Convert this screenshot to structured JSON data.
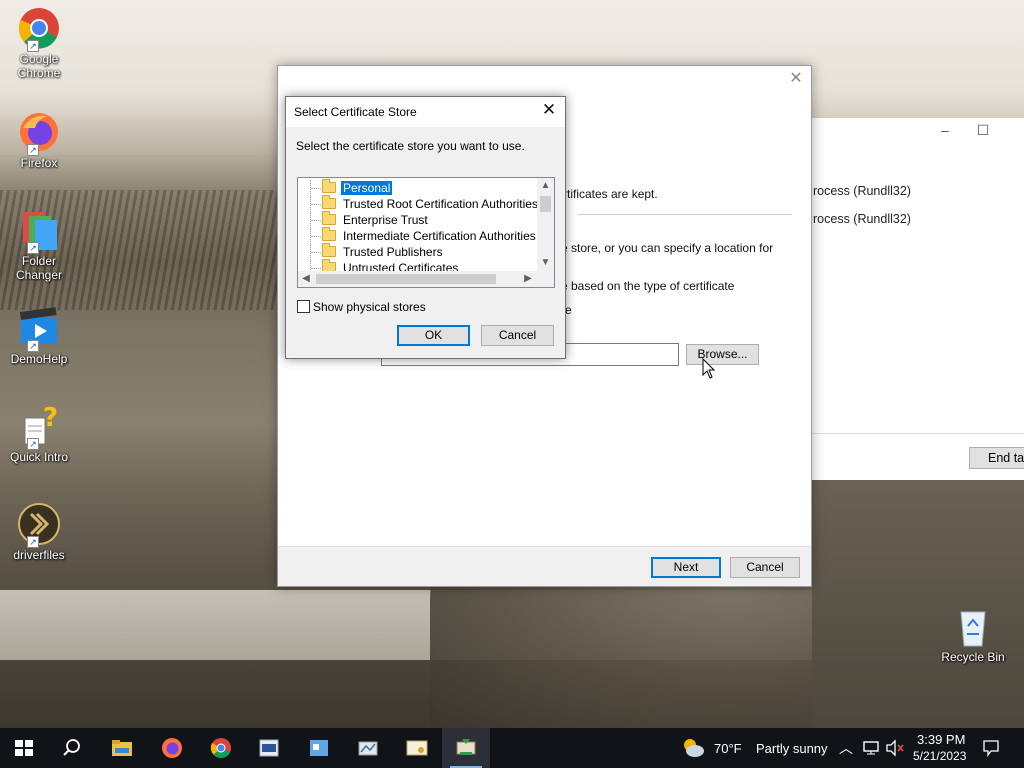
{
  "desktop": {
    "icons": [
      {
        "label": "Google Chrome",
        "icon": "chrome-icon"
      },
      {
        "label": "Firefox",
        "icon": "firefox-icon"
      },
      {
        "label": "Folder Changer",
        "icon": "folder-changer-icon"
      },
      {
        "label": "DemoHelp",
        "icon": "demohelp-icon"
      },
      {
        "label": "Quick Intro",
        "icon": "quick-intro-icon"
      },
      {
        "label": "driverfiles",
        "icon": "driverfiles-icon"
      }
    ],
    "recycle_bin": {
      "label": "Recycle Bin",
      "icon": "recycle-bin-icon"
    }
  },
  "task_manager": {
    "rows": [
      "rocess (Rundll32)",
      "rocess (Rundll32)"
    ],
    "end_task_label": "End tas"
  },
  "wizard": {
    "partial_lines": [
      "rtificates are kept.",
      "e store, or you can specify a location for",
      "e based on the type of certificate",
      "re"
    ],
    "store_path_value": "",
    "browse_label": "Browse...",
    "next_label": "Next",
    "cancel_label": "Cancel"
  },
  "cert_dialog": {
    "title": "Select Certificate Store",
    "prompt": "Select the certificate store you want to use.",
    "stores": [
      {
        "label": "Personal",
        "selected": true
      },
      {
        "label": "Trusted Root Certification Authorities",
        "selected": false
      },
      {
        "label": "Enterprise Trust",
        "selected": false
      },
      {
        "label": "Intermediate Certification Authorities",
        "selected": false
      },
      {
        "label": "Trusted Publishers",
        "selected": false
      },
      {
        "label": "Untrusted Certificates",
        "selected": false
      }
    ],
    "show_physical_label": "Show physical stores",
    "show_physical_checked": false,
    "ok_label": "OK",
    "cancel_label": "Cancel"
  },
  "taskbar": {
    "pinned": [
      "start-icon",
      "search-icon",
      "file-explorer-icon",
      "firefox-icon",
      "chrome-icon",
      "app-icon-1",
      "app-icon-2",
      "app-icon-3",
      "certificate-app-icon",
      "certificate-wizard-icon"
    ],
    "weather": {
      "temp": "70°F",
      "condition": "Partly sunny"
    },
    "time": "3:39 PM",
    "date": "5/21/2023"
  },
  "colors": {
    "accent": "#0078d7",
    "taskbar": "#101419",
    "selection": "#0078d7"
  }
}
